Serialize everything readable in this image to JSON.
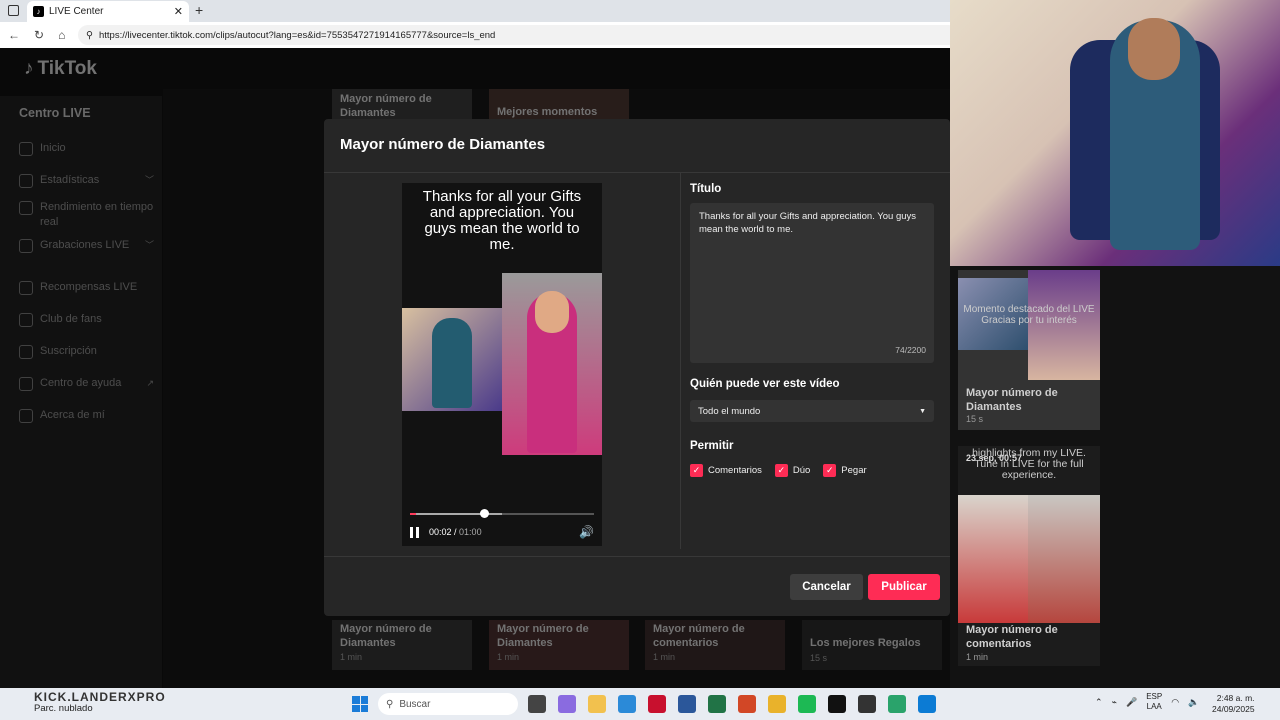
{
  "browser": {
    "tab_title": "LIVE Center",
    "url": "https://livecenter.tiktok.com/clips/autocut?lang=es&id=7553547271914165777&source=ls_end"
  },
  "app": {
    "logo": "TikTok",
    "sidebar_title": "Centro LIVE",
    "sidebar_items": [
      "Inicio",
      "Estadísticas",
      "Rendimiento en tiempo real",
      "Grabaciones LIVE",
      "Recompensas LIVE",
      "Club de fans",
      "Suscripción",
      "Centro de ayuda",
      "Acerca de mí"
    ]
  },
  "cards": {
    "top_left_title": "Mayor número de Diamantes",
    "top_right_title": "Mejores momentos",
    "b1_title": "Mayor número de Diamantes",
    "b1_sub": "1 min",
    "b2_title": "Mayor número de Diamantes",
    "b2_sub": "1 min",
    "b3_title": "Mayor número de comentarios",
    "b3_sub": "1 min",
    "b4_title": "Los mejores Regalos",
    "b4_sub": "15 s",
    "r1_overlay": "Momento destacado del LIVE Gracias por tu interés",
    "r1_title": "Mayor número de Diamantes",
    "r1_sub": "15 s",
    "r2_date": "23 sep, 00:57",
    "r2_overlay": "highlights from my LIVE. Tune in LIVE for the full experience.",
    "r2_title": "Mayor número de comentarios",
    "r2_sub": "1 min"
  },
  "modal": {
    "title": "Mayor número de Diamantes",
    "video_caption": "Thanks for all your Gifts and appreciation. You guys mean the world to me.",
    "time_current": "00:02",
    "time_total": "01:00",
    "progress_fraction": 0.033,
    "buffered_fraction": 0.5,
    "label_title": "Título",
    "title_value": "Thanks for all your Gifts and appreciation. You guys mean the world to me.",
    "char_counter": "74/2200",
    "label_visibility": "Quién puede ver este vídeo",
    "visibility_value": "Todo el mundo",
    "label_allow": "Permitir",
    "allow_comments": "Comentarios",
    "allow_duo": "Dúo",
    "allow_stitch": "Pegar",
    "cancel": "Cancelar",
    "publish": "Publicar"
  },
  "taskbar": {
    "watermark": "KICK.LANDERXPRO",
    "weather": "Parc. nublado",
    "search": "Buscar",
    "lang_top": "ESP",
    "lang_bottom": "LAA",
    "time": "2:48 a. m.",
    "date": "24/09/2025"
  },
  "colors": {
    "accent": "#fe2c55",
    "modal_bg": "#262626",
    "page_bg": "#121212"
  }
}
